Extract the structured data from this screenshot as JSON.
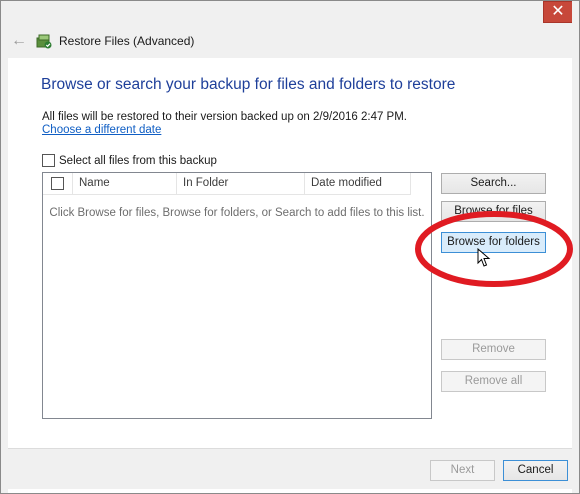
{
  "window": {
    "title": "Restore Files (Advanced)",
    "close_symbol": "✕"
  },
  "icons": {
    "back": "back-arrow-icon",
    "app": "restore-files-icon",
    "cursor": "mouse-pointer-icon"
  },
  "main": {
    "heading": "Browse or search your backup for files and folders to restore",
    "restore_info": "All files will be restored to their version backed up on 2/9/2016 2:47 PM.",
    "change_date_link": "Choose a different date",
    "select_all_label": "Select all files from this backup"
  },
  "list": {
    "columns": [
      "Name",
      "In Folder",
      "Date modified"
    ],
    "empty_message": "Click Browse for files, Browse for folders, or Search to add files to this list."
  },
  "side_buttons": {
    "search": "Search...",
    "browse_files": "Browse for files",
    "browse_folders": "Browse for folders",
    "remove": "Remove",
    "remove_all": "Remove all"
  },
  "footer": {
    "next": "Next",
    "cancel": "Cancel"
  },
  "colors": {
    "heading": "#1e3f9a",
    "link": "#0f5ec4",
    "annotation": "#e01b22",
    "close_button": "#c7483a",
    "highlight_button": "#d9ecfb"
  }
}
